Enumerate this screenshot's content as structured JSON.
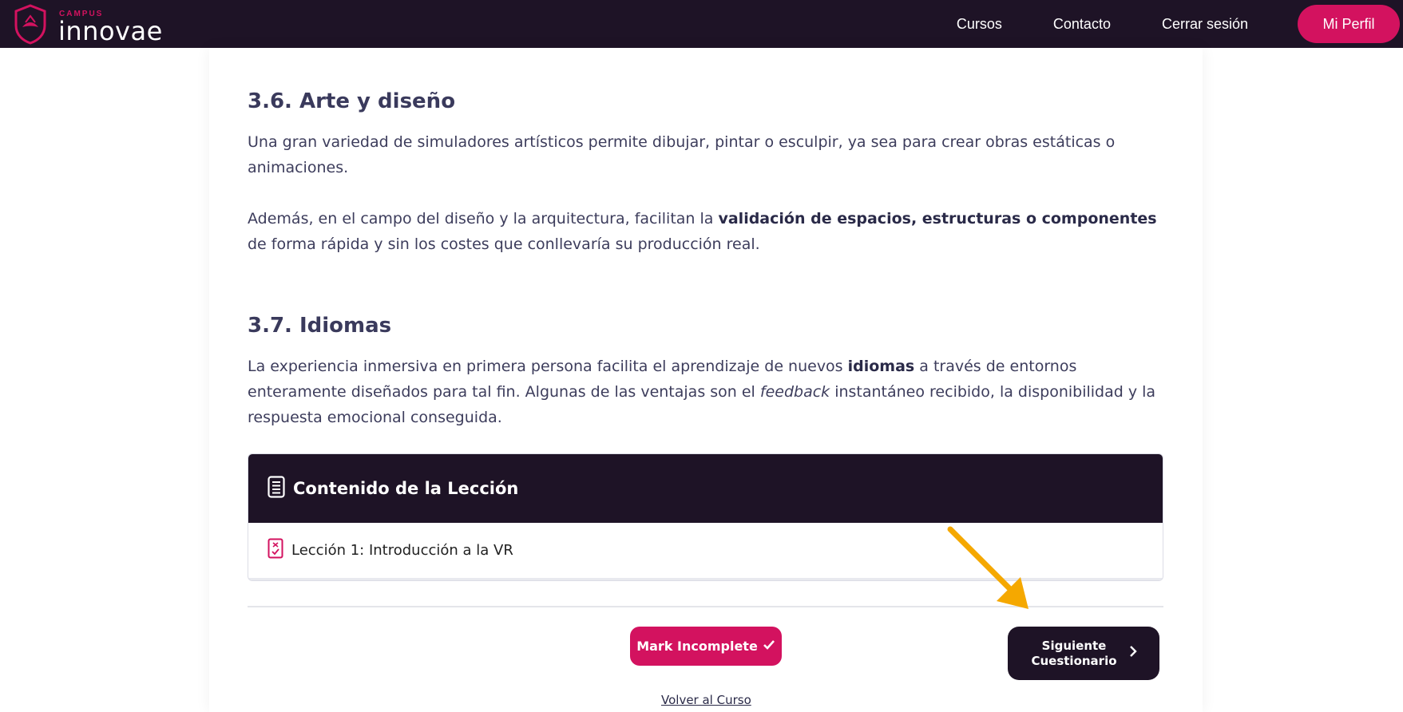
{
  "header": {
    "logo_small": "CAMPUS",
    "logo_big": "innovae",
    "nav": [
      "Cursos",
      "Contacto",
      "Cerrar sesión"
    ],
    "profile_button": "Mi Perfil",
    "brand_color": "#d3125f",
    "bar_color": "#1e1326"
  },
  "sections": [
    {
      "title": "3.6. Arte y diseño",
      "paragraphs": [
        "Una gran variedad de simuladores artísticos permite dibujar, pintar o esculpir, ya sea para crear obras estáticas o animaciones.",
        "Además, en el campo del diseño y la arquitectura, facilitan la validación de espacios, estructuras o componentes de forma rápida y sin los costes que conllevaría su producción real."
      ]
    },
    {
      "title": "3.7. Idiomas",
      "paragraphs": [
        "La experiencia inmersiva en primera persona facilita el aprendizaje de nuevos idiomas a través de entornos enteramente diseñados para tal fin. Algunas de las ventajas son el feedback instantáneo recibido, la disponibilidad y la respuesta emocional conseguida."
      ]
    }
  ],
  "text_parts": {
    "p2a": "Además, en el campo del diseño y la arquitectura, facilitan la ",
    "p2b": "validación de espacios, estructuras o componentes",
    "p2c": " de forma rápida y sin los costes que conllevaría su producción real.",
    "p3a": "La experiencia inmersiva en primera persona facilita el aprendizaje de nuevos ",
    "p3b": "idiomas",
    "p3c": " a través de entornos enteramente diseñados para tal fin. Algunas de las ventajas son el ",
    "p3d": "feedback",
    "p3e": " instantáneo recibido, la disponibilidad y la respuesta emocional conseguida."
  },
  "lesson_box": {
    "title": "Contenido de la Lección",
    "items": [
      "Lección 1: Introducción a la VR"
    ]
  },
  "actions": {
    "mark_incomplete": "Mark Incomplete",
    "next_label": "Siguiente Cuestionario",
    "back_link": "Volver al Curso"
  },
  "annotation_color": "#f5a800"
}
